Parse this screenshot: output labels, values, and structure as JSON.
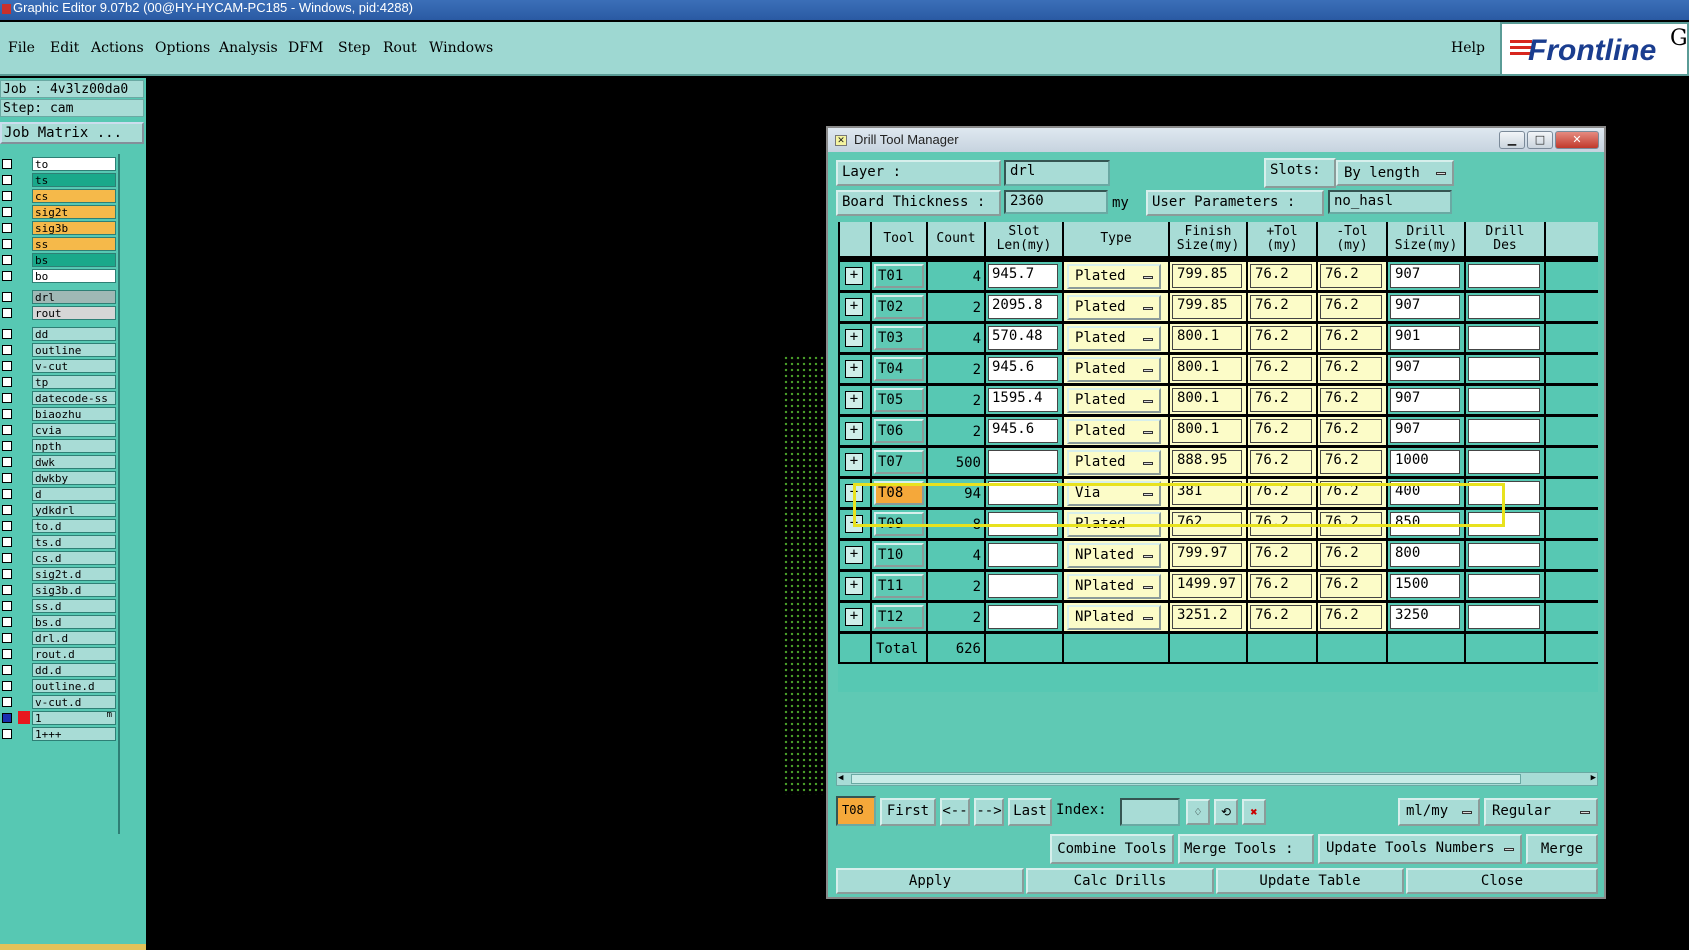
{
  "window_title": "Graphic Editor 9.07b2 (00@HY-HYCAM-PC185 - Windows, pid:4288)",
  "menu": [
    "File",
    "Edit",
    "Actions",
    "Options",
    "Analysis",
    "DFM",
    "Step",
    "Rout",
    "Windows"
  ],
  "help": "Help",
  "logo": {
    "text": "Frontline",
    "suffix": "G"
  },
  "job": {
    "job_line": "Job : 4v3lz00da0",
    "step_line": "Step: cam",
    "matrix_button": "Job Matrix ..."
  },
  "layers": [
    {
      "name": "to",
      "color": "#ffffff"
    },
    {
      "name": "ts",
      "color": "#1aa88a"
    },
    {
      "name": "cs",
      "color": "#f5b94a"
    },
    {
      "name": "sig2t",
      "color": "#f5b94a"
    },
    {
      "name": "sig3b",
      "color": "#f5b94a"
    },
    {
      "name": "ss",
      "color": "#f5b94a"
    },
    {
      "name": "bs",
      "color": "#1aa88a"
    },
    {
      "name": "bo",
      "color": "#ffffff"
    },
    {
      "name": "drl",
      "color": "#9fb8b5"
    },
    {
      "name": "rout",
      "color": "#d6d6d6"
    },
    {
      "name": "dd",
      "color": "#a8dcd6"
    },
    {
      "name": "outline",
      "color": "#a8dcd6"
    },
    {
      "name": "v-cut",
      "color": "#a8dcd6"
    },
    {
      "name": "tp",
      "color": "#a8dcd6"
    },
    {
      "name": "datecode-ss",
      "color": "#a8dcd6"
    },
    {
      "name": "biaozhu",
      "color": "#a8dcd6"
    },
    {
      "name": "cvia",
      "color": "#a8dcd6"
    },
    {
      "name": "npth",
      "color": "#a8dcd6"
    },
    {
      "name": "dwk",
      "color": "#a8dcd6"
    },
    {
      "name": "dwkby",
      "color": "#a8dcd6"
    },
    {
      "name": "d",
      "color": "#a8dcd6"
    },
    {
      "name": "ydkdrl",
      "color": "#a8dcd6"
    },
    {
      "name": "to.d",
      "color": "#a8dcd6"
    },
    {
      "name": "ts.d",
      "color": "#a8dcd6"
    },
    {
      "name": "cs.d",
      "color": "#a8dcd6"
    },
    {
      "name": "sig2t.d",
      "color": "#a8dcd6"
    },
    {
      "name": "sig3b.d",
      "color": "#a8dcd6"
    },
    {
      "name": "ss.d",
      "color": "#a8dcd6"
    },
    {
      "name": "bs.d",
      "color": "#a8dcd6"
    },
    {
      "name": "drl.d",
      "color": "#a8dcd6"
    },
    {
      "name": "rout.d",
      "color": "#a8dcd6"
    },
    {
      "name": "dd.d",
      "color": "#a8dcd6"
    },
    {
      "name": "outline.d",
      "color": "#a8dcd6"
    },
    {
      "name": "v-cut.d",
      "color": "#a8dcd6"
    },
    {
      "name": "1",
      "color": "#a8dcd6",
      "mark": "m"
    },
    {
      "name": "1+++",
      "color": "#a8dcd6"
    }
  ],
  "dtm": {
    "title": "Drill Tool Manager",
    "layer_label": "Layer :",
    "layer_value": "drl",
    "slots_label": "Slots:",
    "slots_value": "By length",
    "thickness_label": "Board Thickness :",
    "thickness_value": "2360",
    "thickness_unit": "my",
    "user_params_label": "User Parameters :",
    "user_params_value": "no_hasl",
    "headers": [
      {
        "key": "tool",
        "l1": "Tool",
        "l2": ""
      },
      {
        "key": "count",
        "l1": "Count",
        "l2": ""
      },
      {
        "key": "slot",
        "l1": "Slot",
        "l2": "Len(my)"
      },
      {
        "key": "type",
        "l1": "Type",
        "l2": ""
      },
      {
        "key": "finish",
        "l1": "Finish",
        "l2": "Size(my)"
      },
      {
        "key": "ptol",
        "l1": "+Tol",
        "l2": "(my)"
      },
      {
        "key": "mtol",
        "l1": "-Tol",
        "l2": "(my)"
      },
      {
        "key": "drill",
        "l1": "Drill",
        "l2": "Size(my)"
      },
      {
        "key": "des",
        "l1": "Drill",
        "l2": "Des"
      }
    ],
    "rows": [
      {
        "tool": "T01",
        "count": "4",
        "slot": "945.7",
        "type": "Plated",
        "finish": "799.85",
        "ptol": "76.2",
        "mtol": "76.2",
        "drill": "907",
        "des": ""
      },
      {
        "tool": "T02",
        "count": "2",
        "slot": "2095.8",
        "type": "Plated",
        "finish": "799.85",
        "ptol": "76.2",
        "mtol": "76.2",
        "drill": "907",
        "des": ""
      },
      {
        "tool": "T03",
        "count": "4",
        "slot": "570.48",
        "type": "Plated",
        "finish": "800.1",
        "ptol": "76.2",
        "mtol": "76.2",
        "drill": "901",
        "des": ""
      },
      {
        "tool": "T04",
        "count": "2",
        "slot": "945.6",
        "type": "Plated",
        "finish": "800.1",
        "ptol": "76.2",
        "mtol": "76.2",
        "drill": "907",
        "des": ""
      },
      {
        "tool": "T05",
        "count": "2",
        "slot": "1595.4",
        "type": "Plated",
        "finish": "800.1",
        "ptol": "76.2",
        "mtol": "76.2",
        "drill": "907",
        "des": ""
      },
      {
        "tool": "T06",
        "count": "2",
        "slot": "945.6",
        "type": "Plated",
        "finish": "800.1",
        "ptol": "76.2",
        "mtol": "76.2",
        "drill": "907",
        "des": ""
      },
      {
        "tool": "T07",
        "count": "500",
        "slot": "",
        "type": "Plated",
        "finish": "888.95",
        "ptol": "76.2",
        "mtol": "76.2",
        "drill": "1000",
        "des": ""
      },
      {
        "tool": "T08",
        "count": "94",
        "slot": "",
        "type": "Via",
        "finish": "381",
        "ptol": "76.2",
        "mtol": "76.2",
        "drill": "400",
        "des": ""
      },
      {
        "tool": "T09",
        "count": "8",
        "slot": "",
        "type": "Plated",
        "finish": "762",
        "ptol": "76.2",
        "mtol": "76.2",
        "drill": "850",
        "des": ""
      },
      {
        "tool": "T10",
        "count": "4",
        "slot": "",
        "type": "NPlated",
        "finish": "799.97",
        "ptol": "76.2",
        "mtol": "76.2",
        "drill": "800",
        "des": ""
      },
      {
        "tool": "T11",
        "count": "2",
        "slot": "",
        "type": "NPlated",
        "finish": "1499.97",
        "ptol": "76.2",
        "mtol": "76.2",
        "drill": "1500",
        "des": ""
      },
      {
        "tool": "T12",
        "count": "2",
        "slot": "",
        "type": "NPlated",
        "finish": "3251.2",
        "ptol": "76.2",
        "mtol": "76.2",
        "drill": "3250",
        "des": ""
      }
    ],
    "selected_tool": "T08",
    "total_label": "Total",
    "total_count": "626",
    "nav": {
      "current": "T08",
      "first": "First",
      "prev": "<--",
      "next": "-->",
      "last": "Last",
      "index_label": "Index:"
    },
    "units_value": "ml/my",
    "mode_value": "Regular",
    "combine": "Combine Tools",
    "merge_label": "Merge Tools :",
    "update_numbers": "Update Tools Numbers",
    "merge": "Merge",
    "apply": "Apply",
    "calc": "Calc Drills",
    "update_table": "Update Table",
    "close": "Close"
  }
}
